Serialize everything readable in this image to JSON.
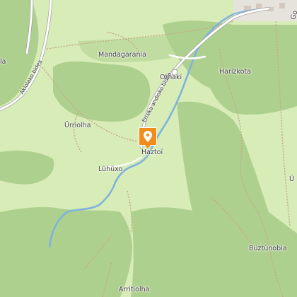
{
  "map": {
    "colors": {
      "grass": "#d7ecb7",
      "forest": "#aed08e",
      "water": "#7fb3dd",
      "road": "#ffffff",
      "path": "#c7a78a",
      "marker": "#f28c1c"
    },
    "places": {
      "mandagarania": "Mandagarania",
      "othaki": "Othaki",
      "harizkota": "Harizkota",
      "urriolha": "Ürriolha",
      "haztoi": "Haztoï",
      "luhuxo": "Lühüxo",
      "buztunobia": "Büztünobia",
      "arritiolha": "Arritiolha",
      "edge_left_la": "la",
      "edge_right_u": "Ü",
      "edge_top_right_go": "Go"
    },
    "roads": {
      "aklolako_bidea": "Aklolako bidea",
      "erreka_andioko_bidea": "Erreka andioko bidea"
    },
    "marker": {
      "icon": "map-pin-icon",
      "for_place": "Haztoï"
    }
  }
}
